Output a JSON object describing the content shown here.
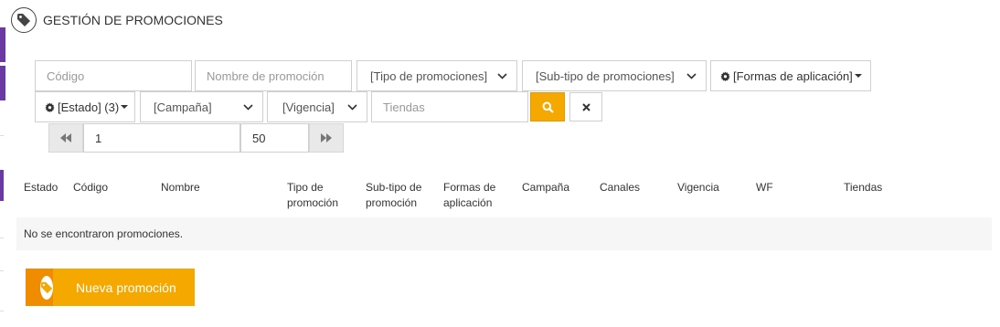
{
  "header": {
    "title": "GESTIÓN DE PROMOCIONES",
    "icon": "tag-icon"
  },
  "filters": {
    "codigo_placeholder": "Código",
    "nombre_placeholder": "Nombre de promoción",
    "tipo_selected": "[Tipo de promociones]",
    "subtipo_selected": "[Sub-tipo de promociones]",
    "formas_label": "[Formas de aplicación]",
    "estado_label": "[Estado] (3)",
    "campana_selected": "[Campaña]",
    "vigencia_selected": "[Vigencia]",
    "tiendas_placeholder": "Tiendas"
  },
  "pager": {
    "page": "1",
    "page_size": "50"
  },
  "table": {
    "columns": [
      [
        "Estado"
      ],
      [
        "Código"
      ],
      [
        "Nombre"
      ],
      [
        "Tipo de",
        "promoción"
      ],
      [
        "Sub-tipo de",
        "promoción"
      ],
      [
        "Formas de",
        "aplicación"
      ],
      [
        "Campaña"
      ],
      [
        "Canales"
      ],
      [
        "Vigencia"
      ],
      [
        "WF"
      ],
      [
        "Tiendas"
      ]
    ],
    "empty_message": "No se encontraron promociones."
  },
  "actions": {
    "new_label": "Nueva promoción"
  },
  "colors": {
    "accent": "#f5a800",
    "accent_dark": "#f08c00",
    "sidebar": "#6a3aa2"
  }
}
